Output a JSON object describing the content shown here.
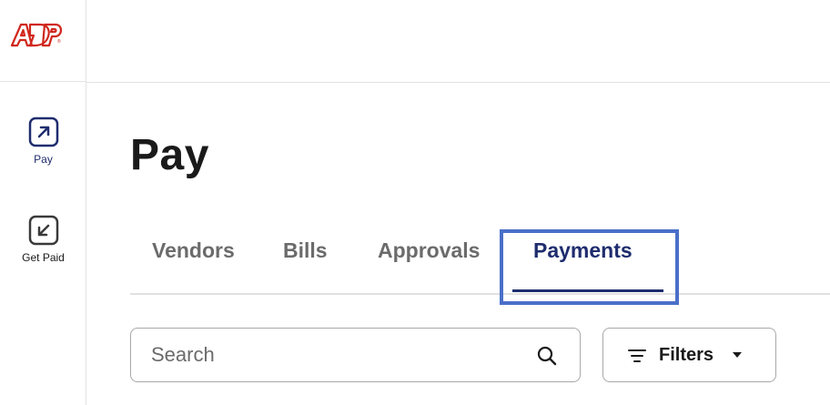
{
  "brand": {
    "logo_text": "ADP",
    "logo_color": "#d0271d"
  },
  "sidebar": {
    "items": [
      {
        "label": "Pay",
        "icon": "arrow-up-right-icon",
        "active": true
      },
      {
        "label": "Get Paid",
        "icon": "arrow-down-left-icon",
        "active": false
      }
    ]
  },
  "page": {
    "title": "Pay"
  },
  "tabs": {
    "items": [
      {
        "label": "Vendors"
      },
      {
        "label": "Bills"
      },
      {
        "label": "Approvals"
      },
      {
        "label": "Payments",
        "active": true
      }
    ]
  },
  "search": {
    "placeholder": "Search",
    "value": ""
  },
  "filters": {
    "label": "Filters"
  },
  "colors": {
    "accent": "#1f2d6e",
    "highlight": "#4a6fc9",
    "brand_red": "#d0271d"
  }
}
